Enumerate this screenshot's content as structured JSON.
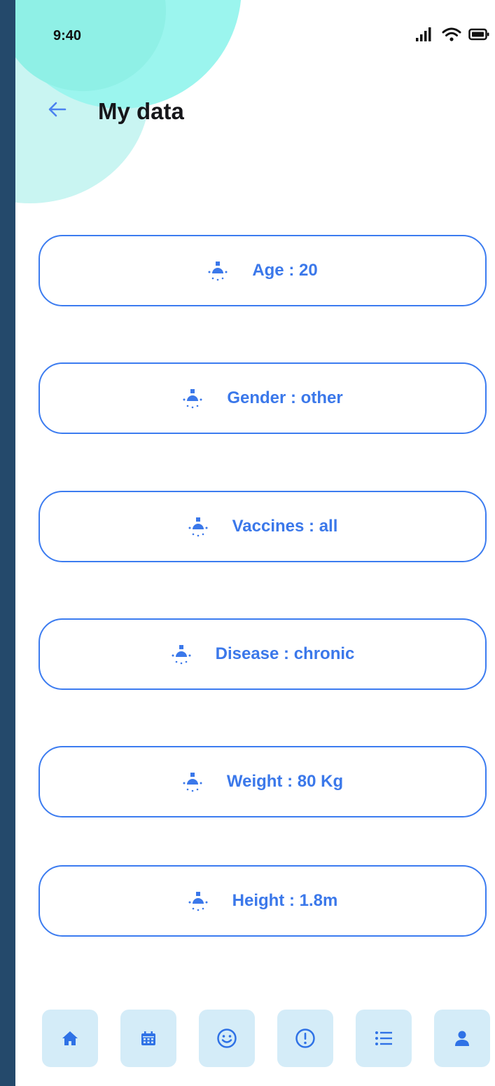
{
  "status_bar": {
    "time": "9:40",
    "icons": [
      "signal-icon",
      "wifi-icon",
      "battery-icon"
    ]
  },
  "header": {
    "title": "My data",
    "back_icon": "arrow-left-icon"
  },
  "cards": [
    {
      "label": "Age : 20",
      "icon": "bulb-icon"
    },
    {
      "label": "Gender : other",
      "icon": "bulb-icon"
    },
    {
      "label": "Vaccines : all",
      "icon": "bulb-icon"
    },
    {
      "label": "Disease : chronic",
      "icon": "bulb-icon"
    },
    {
      "label": "Weight : 80 Kg",
      "icon": "bulb-icon"
    },
    {
      "label": "Height : 1.8m",
      "icon": "bulb-icon"
    }
  ],
  "bottom_nav": {
    "items": [
      "home-icon",
      "calendar-icon",
      "smiley-icon",
      "alert-icon",
      "list-icon",
      "user-icon"
    ]
  },
  "colors": {
    "accent": "#3b78ea",
    "card_border": "#3c7cf0",
    "nav_button_bg": "#d4ecf8",
    "blob": "#9bf5ee",
    "outer_background": "#24496b"
  }
}
